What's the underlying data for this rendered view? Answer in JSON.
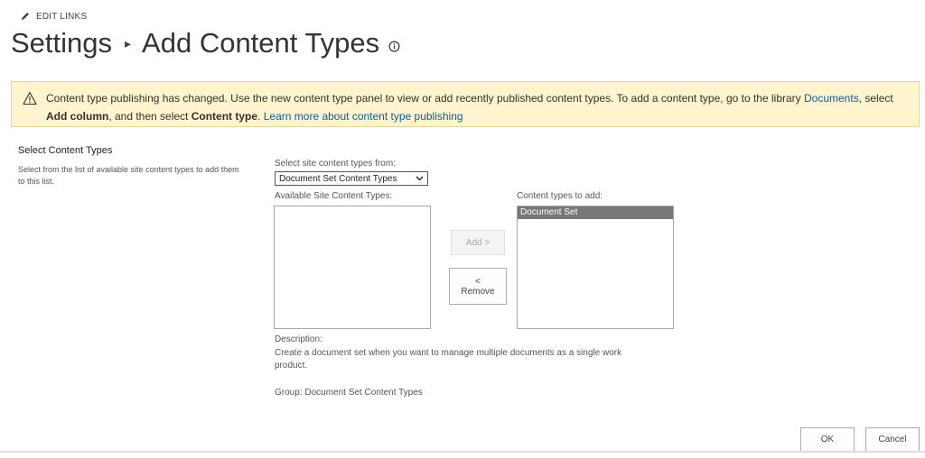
{
  "edit_links": {
    "label": "EDIT LINKS",
    "icon": "pencil-icon"
  },
  "breadcrumb": {
    "parent": "Settings",
    "separator": "▸",
    "current": "Add Content Types",
    "info_icon": "info-icon"
  },
  "banner": {
    "icon": "warning-icon",
    "text_before_link": "Content type publishing has changed. Use the new content type panel to view or add recently published content types. To add a content type, go to the library ",
    "library_link": "Documents",
    "text_select": ", select ",
    "add_column": "Add column",
    "text_then": ", and then select ",
    "content_type": "Content type",
    "text_period": ". ",
    "learn_more_link": "Learn more about content type publishing",
    "background_color": "#fff4ce"
  },
  "section": {
    "title": "Select Content Types",
    "description": "Select from the list of available site content types to add them to this list."
  },
  "source_select": {
    "label": "Select site content types from:",
    "value": "Document Set Content Types"
  },
  "available_list": {
    "label": "Available Site Content Types:",
    "items": []
  },
  "add_button": {
    "label": "Add >"
  },
  "remove_button": {
    "label_line1": "<",
    "label_line2": "Remove"
  },
  "to_add_list": {
    "label": "Content types to add:",
    "items": [
      "Document Set"
    ]
  },
  "description": {
    "label": "Description:",
    "text": "Create a document set when you want to manage multiple documents as a single work product.",
    "group": "Group: Document Set Content Types"
  },
  "footer": {
    "ok_label": "OK",
    "cancel_label": "Cancel"
  }
}
